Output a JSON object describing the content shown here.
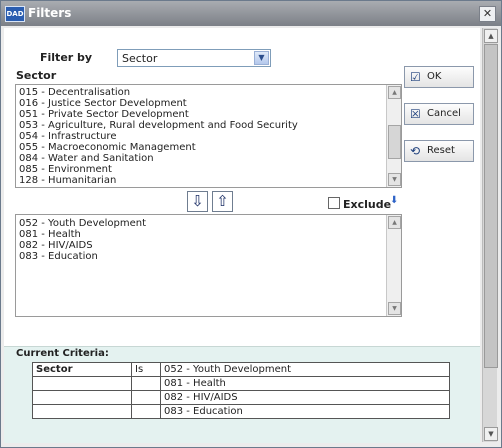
{
  "window": {
    "title": "Filters",
    "app_icon_text": "DAD"
  },
  "filter_by": {
    "label": "Filter by",
    "selected": "Sector"
  },
  "sector_label": "Sector",
  "available_items": [
    "015 - Decentralisation",
    "016 - Justice Sector Development",
    "051 - Private Sector Development",
    "053 - Agriculture, Rural development and Food Security",
    "054 - Infrastructure",
    "055 - Macroeconomic Management",
    "084 - Water and Sanitation",
    "085 - Environment",
    "128 - Humanitarian"
  ],
  "selected_items": [
    "052 - Youth Development",
    "081 - Health",
    "082 - HIV/AIDS",
    "083 - Education"
  ],
  "buttons": {
    "ok": "OK",
    "cancel": "Cancel",
    "reset": "Reset"
  },
  "exclude_label": "Exclude",
  "criteria": {
    "title": "Current Criteria:",
    "field": "Sector",
    "operator": "Is",
    "values": [
      "052 - Youth Development",
      "081 - Health",
      "082 - HIV/AIDS",
      "083 - Education"
    ]
  }
}
